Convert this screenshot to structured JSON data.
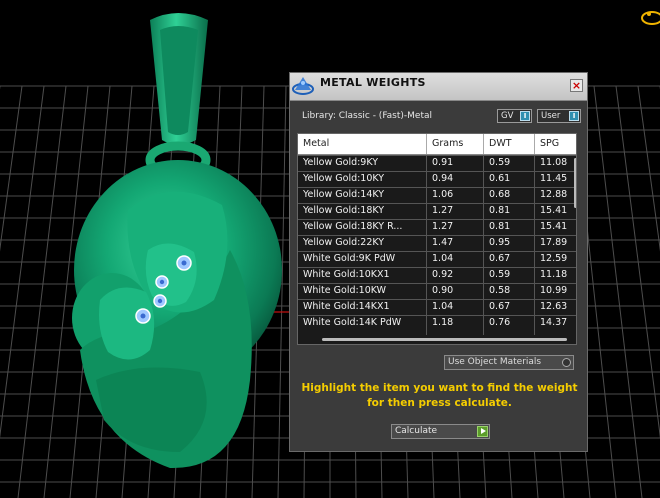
{
  "panel": {
    "title": "METAL WEIGHTS",
    "close_label": "×",
    "library_label": "Library: Classic - (Fast)-Metal",
    "units_dropdown": "GV",
    "user_dropdown": "User",
    "table": {
      "columns": [
        "Metal",
        "Grams",
        "DWT",
        "SPG"
      ],
      "rows": [
        [
          "Yellow Gold:9KY",
          "0.91",
          "0.59",
          "11.08"
        ],
        [
          "Yellow Gold:10KY",
          "0.94",
          "0.61",
          "11.45"
        ],
        [
          "Yellow Gold:14KY",
          "1.06",
          "0.68",
          "12.88"
        ],
        [
          "Yellow Gold:18KY",
          "1.27",
          "0.81",
          "15.41"
        ],
        [
          "Yellow Gold:18KY R...",
          "1.27",
          "0.81",
          "15.41"
        ],
        [
          "Yellow Gold:22KY",
          "1.47",
          "0.95",
          "17.89"
        ],
        [
          "White Gold:9K PdW",
          "1.04",
          "0.67",
          "12.59"
        ],
        [
          "White Gold:10KX1",
          "0.92",
          "0.59",
          "11.18"
        ],
        [
          "White Gold:10KW",
          "0.90",
          "0.58",
          "10.99"
        ],
        [
          "White Gold:14KX1",
          "1.04",
          "0.67",
          "12.63"
        ],
        [
          "White Gold:14K PdW",
          "1.18",
          "0.76",
          "14.37"
        ]
      ]
    },
    "use_object_materials_label": "Use Object Materials",
    "hint_line1": "Highlight the item you want to find the weight",
    "hint_line2": "for then press calculate.",
    "calculate_dropdown": "Calculate",
    "accent_color": "#f5cd00"
  }
}
